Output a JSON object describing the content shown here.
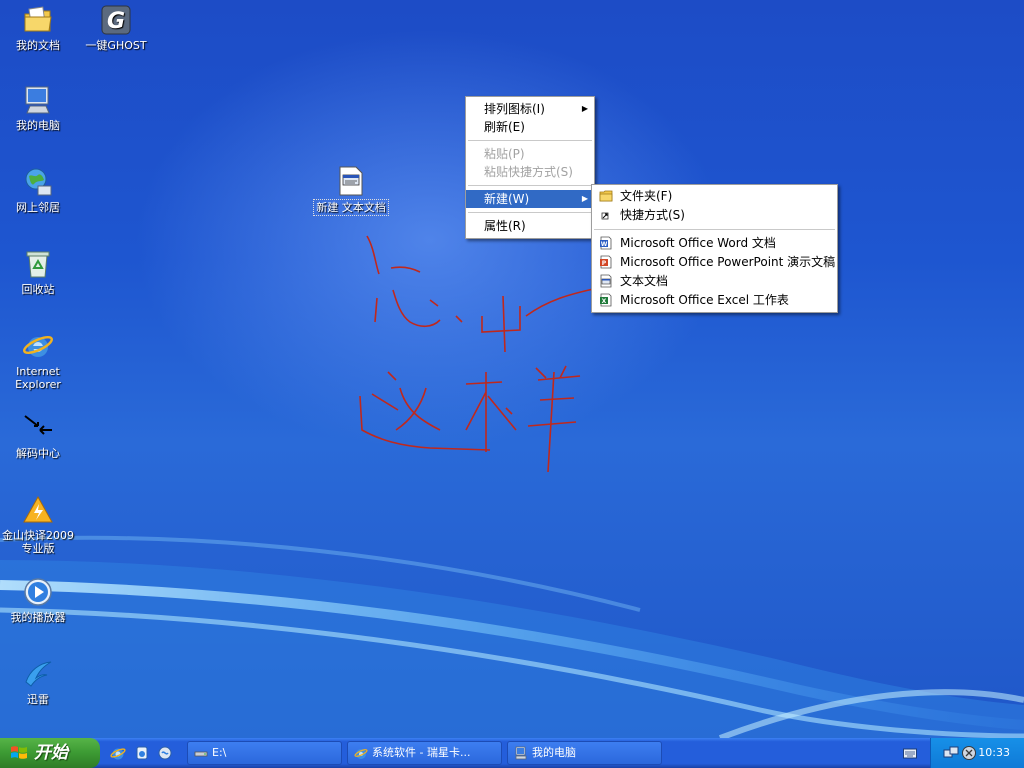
{
  "desktop_icons": [
    {
      "label": "我的文档",
      "icon": "my-documents-icon"
    },
    {
      "label": "一键GHOST",
      "icon": "ghost-icon"
    },
    {
      "label": "我的电脑",
      "icon": "my-computer-icon"
    },
    {
      "label": "网上邻居",
      "icon": "network-icon"
    },
    {
      "label": "回收站",
      "icon": "recycle-bin-icon"
    },
    {
      "label": "Internet Explorer",
      "icon": "internet-explorer-icon"
    },
    {
      "label": "解码中心",
      "icon": "codec-center-icon"
    },
    {
      "label": "金山快译2009 专业版",
      "icon": "kingsoft-translator-icon"
    },
    {
      "label": "我的播放器",
      "icon": "media-player-icon"
    },
    {
      "label": "迅雷",
      "icon": "thunder-icon"
    },
    {
      "label": "新建 文本文档",
      "icon": "text-document-icon"
    }
  ],
  "context_menu": {
    "items": [
      {
        "label": "排列图标(I)",
        "disabled": false,
        "submenu": true
      },
      {
        "label": "刷新(E)",
        "disabled": false
      },
      {
        "label": "粘贴(P)",
        "disabled": true
      },
      {
        "label": "粘贴快捷方式(S)",
        "disabled": true
      },
      {
        "label": "新建(W)",
        "disabled": false,
        "submenu": true,
        "selected": true
      },
      {
        "label": "属性(R)",
        "disabled": false
      }
    ]
  },
  "new_submenu": {
    "items": [
      {
        "label": "文件夹(F)",
        "icon": "folder-icon"
      },
      {
        "label": "快捷方式(S)",
        "icon": "shortcut-icon"
      },
      {
        "label": "Microsoft Office Word 文档",
        "icon": "word-icon"
      },
      {
        "label": "Microsoft Office PowerPoint 演示文稿",
        "icon": "powerpoint-icon"
      },
      {
        "label": "文本文档",
        "icon": "text-file-icon"
      },
      {
        "label": "Microsoft Office Excel 工作表",
        "icon": "excel-icon"
      }
    ]
  },
  "taskbar": {
    "start_label": "开始",
    "quick_launch": [
      "internet-explorer-icon",
      "media-icon",
      "show-desktop-icon"
    ],
    "tasks": [
      {
        "label": "E:\\",
        "icon": "drive-icon"
      },
      {
        "label": "系统软件 - 瑞星卡...",
        "icon": "internet-explorer-icon"
      },
      {
        "label": "我的电脑",
        "icon": "my-computer-icon"
      }
    ],
    "clock": "10:33"
  },
  "colors": {
    "desktop": "#1e56d0",
    "menu_highlight": "#316ac5",
    "annotation": "#c0281c",
    "start_green": "#3c9a33",
    "taskbar_blue": "#245edb"
  }
}
